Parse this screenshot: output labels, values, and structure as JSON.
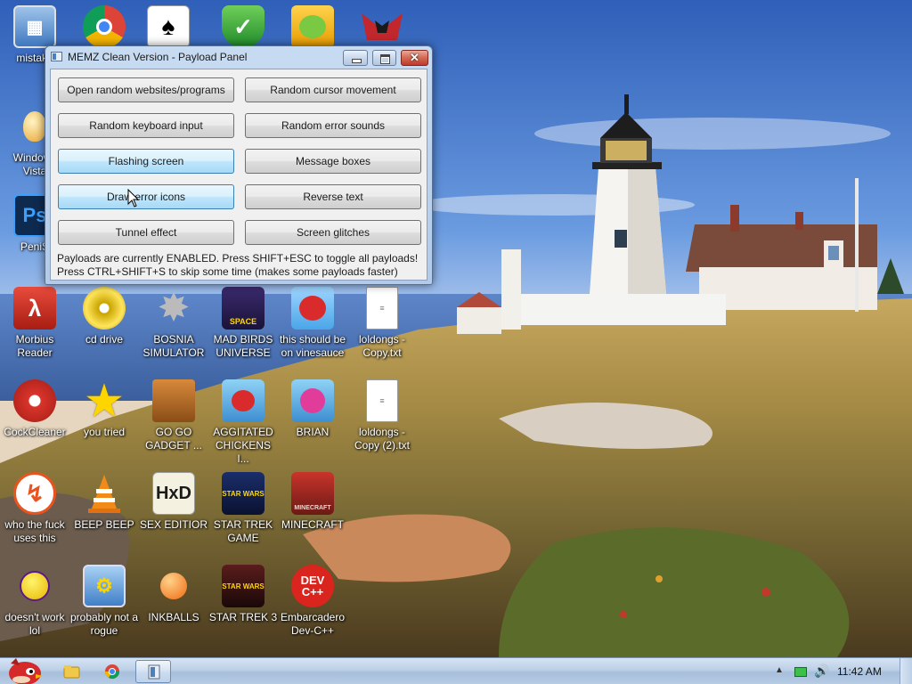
{
  "window": {
    "title": "MEMZ Clean Version - Payload Panel",
    "buttons": [
      "Open random websites/programs",
      "Random cursor movement",
      "Random keyboard input",
      "Random error sounds",
      "Flashing screen",
      "Message boxes",
      "Draw error icons",
      "Reverse text",
      "Tunnel effect",
      "Screen glitches"
    ],
    "status_line1": "Payloads are currently ENABLED. Press SHIFT+ESC to toggle all payloads!",
    "status_line2": "Press CTRL+SHIFT+S to skip some time (makes some payloads faster)"
  },
  "desktop_icons": [
    {
      "label": "mistake",
      "icon": "computer-icon"
    },
    {
      "label": "",
      "icon": "chrome-icon"
    },
    {
      "label": "",
      "icon": "solitaire-icon"
    },
    {
      "label": "",
      "icon": "security-shield-icon"
    },
    {
      "label": "",
      "icon": "bad-piggies-icon"
    },
    {
      "label": "",
      "icon": "red-logo-icon"
    },
    {
      "label": "Windows Vista",
      "icon": "egg-icon"
    },
    {
      "label": "PeniS",
      "icon": "photoshop-icon"
    },
    {
      "label": "Morbius Reader",
      "icon": "pdf-reader-icon"
    },
    {
      "label": "cd drive",
      "icon": "cd-drive-icon"
    },
    {
      "label": "BOSNIA SIMULATOR",
      "icon": "spiked-ball-icon"
    },
    {
      "label": "MAD BIRDS UNIVERSE",
      "icon": "angry-birds-space-icon"
    },
    {
      "label": "this should be on vinesauce",
      "icon": "angry-bird-icon"
    },
    {
      "label": "loldongs - Copy.txt",
      "icon": "text-file-icon"
    },
    {
      "label": "CockCleaner",
      "icon": "ccleaner-icon"
    },
    {
      "label": "you tried",
      "icon": "star-icon"
    },
    {
      "label": "GO GO GADGET ...",
      "icon": "briefcase-icon"
    },
    {
      "label": "AGGITATED CHICKENS I...",
      "icon": "angry-birds-icon"
    },
    {
      "label": "BRIAN",
      "icon": "angry-birds-bird-icon"
    },
    {
      "label": "loldongs - Copy (2).txt",
      "icon": "text-file-icon"
    },
    {
      "label": "who the fuck uses this",
      "icon": "lightning-icon"
    },
    {
      "label": "BEEP BEEP",
      "icon": "traffic-cone-icon"
    },
    {
      "label": "SEX EDITIOR",
      "icon": "hxd-editor-icon"
    },
    {
      "label": "STAR TREK GAME",
      "icon": "angry-birds-star-wars-icon"
    },
    {
      "label": "MINECRAFT",
      "icon": "minecraft-icon"
    },
    {
      "label": "doesn't work lol",
      "icon": "yahoo-messenger-icon"
    },
    {
      "label": "probably not a rogue",
      "icon": "control-panel-icon"
    },
    {
      "label": "INKBALLS",
      "icon": "inkball-icon"
    },
    {
      "label": "STAR TREK 3",
      "icon": "star-wars-icon"
    },
    {
      "label": "Embarcadero Dev-C++",
      "icon": "dev-cpp-icon"
    }
  ],
  "icon_text": {
    "photoshop": "Ps",
    "spike": "SPACE",
    "hxd": "HxD",
    "minecraft": "MINECRAFT",
    "dev": "DEV",
    "cpp": "C++",
    "starwars": "STAR WARS"
  },
  "taskbar": {
    "clock": "11:42 AM"
  },
  "colors": {
    "window_frame": "#b3cbe9",
    "button_hover": "#bee6fd",
    "taskbar": "#bcd0e7"
  }
}
